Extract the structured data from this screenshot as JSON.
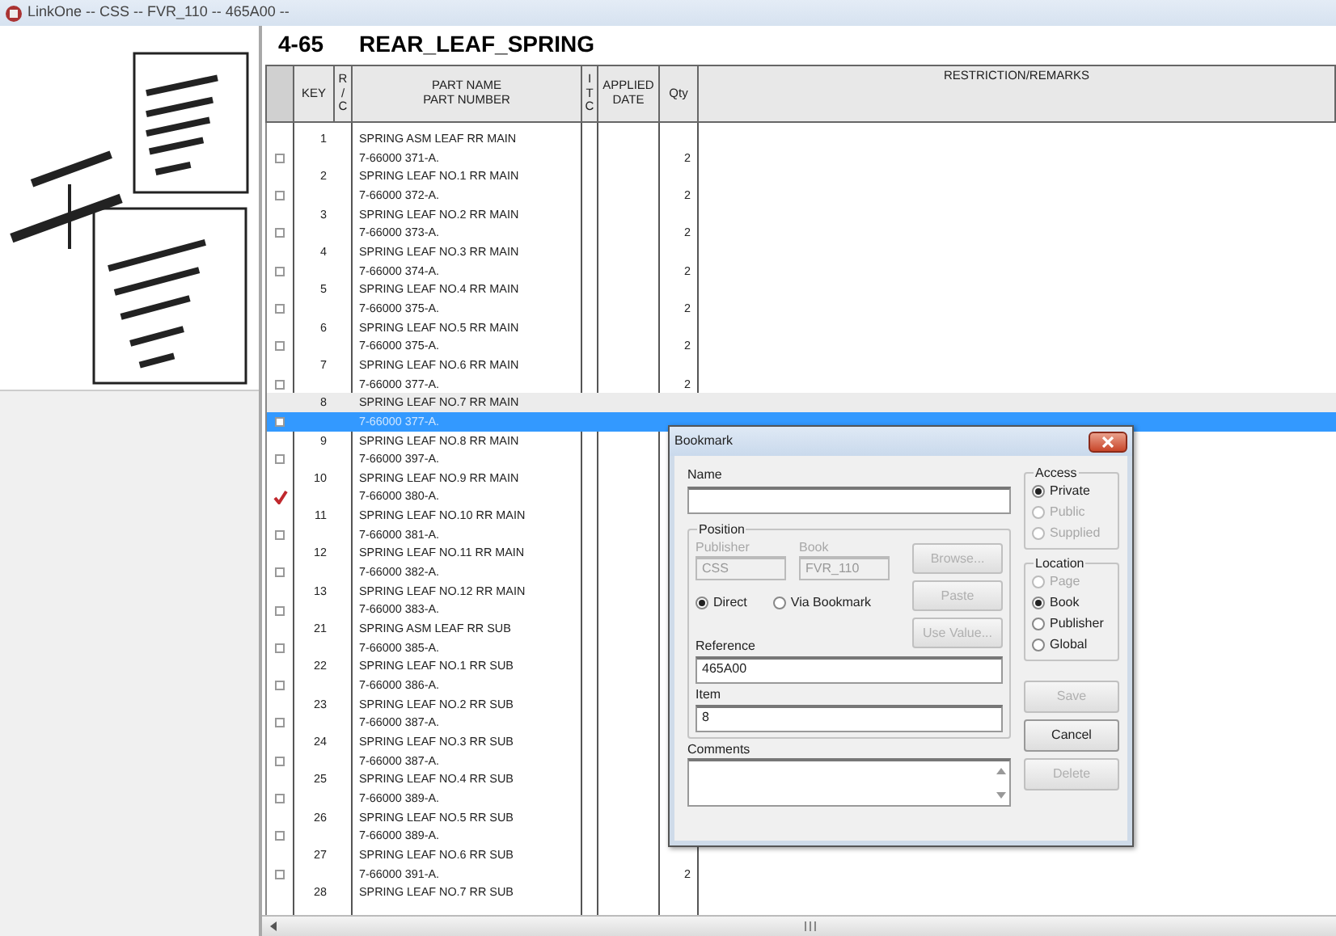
{
  "window": {
    "title": "LinkOne -- CSS -- FVR_110 -- 465A00 --"
  },
  "page": {
    "number": "4-65",
    "title": "REAR_LEAF_SPRING"
  },
  "table": {
    "columns": [
      {
        "kind": "key",
        "lines": [
          "KEY"
        ]
      },
      {
        "kind": "rc",
        "lines": [
          "R",
          "/",
          "C"
        ]
      },
      {
        "kind": "part",
        "lines": [
          "PART NAME",
          "PART NUMBER"
        ]
      },
      {
        "kind": "itc",
        "lines": [
          "I",
          "T",
          "C"
        ]
      },
      {
        "kind": "date",
        "lines": [
          "APPLIED",
          "DATE"
        ]
      },
      {
        "kind": "qty",
        "lines": [
          "Qty"
        ]
      },
      {
        "kind": "remarks",
        "lines": [
          "RESTRICTION/REMARKS"
        ]
      }
    ],
    "rows": [
      {
        "key": "1",
        "part_name": "SPRING ASM LEAF RR MAIN",
        "part_number": "7-66000 371-A.",
        "qty": "2",
        "checked": false,
        "selected": false
      },
      {
        "key": "2",
        "part_name": "SPRING LEAF NO.1 RR MAIN",
        "part_number": "7-66000 372-A.",
        "qty": "2",
        "checked": false,
        "selected": false
      },
      {
        "key": "3",
        "part_name": "SPRING LEAF NO.2 RR MAIN",
        "part_number": "7-66000 373-A.",
        "qty": "2",
        "checked": false,
        "selected": false
      },
      {
        "key": "4",
        "part_name": "SPRING LEAF NO.3 RR MAIN",
        "part_number": "7-66000 374-A.",
        "qty": "2",
        "checked": false,
        "selected": false
      },
      {
        "key": "5",
        "part_name": "SPRING LEAF NO.4 RR MAIN",
        "part_number": "7-66000 375-A.",
        "qty": "2",
        "checked": false,
        "selected": false
      },
      {
        "key": "6",
        "part_name": "SPRING LEAF NO.5 RR MAIN",
        "part_number": "7-66000 375-A.",
        "qty": "2",
        "checked": false,
        "selected": false
      },
      {
        "key": "7",
        "part_name": "SPRING LEAF NO.6 RR MAIN",
        "part_number": "7-66000 377-A.",
        "qty": "2",
        "checked": false,
        "selected": false
      },
      {
        "key": "8",
        "part_name": "SPRING LEAF NO.7 RR MAIN",
        "part_number": "7-66000 377-A.",
        "checked": false,
        "selected": true
      },
      {
        "key": "9",
        "part_name": "SPRING LEAF NO.8 RR MAIN",
        "part_number": "7-66000 397-A.",
        "checked": false,
        "selected": false
      },
      {
        "key": "10",
        "part_name": "SPRING LEAF NO.9 RR MAIN",
        "part_number": "7-66000 380-A.",
        "checked": true,
        "selected": false
      },
      {
        "key": "11",
        "part_name": "SPRING LEAF NO.10 RR MAIN",
        "part_number": "7-66000 381-A.",
        "checked": false,
        "selected": false
      },
      {
        "key": "12",
        "part_name": "SPRING LEAF NO.11 RR MAIN",
        "part_number": "7-66000 382-A.",
        "checked": false,
        "selected": false
      },
      {
        "key": "13",
        "part_name": "SPRING LEAF NO.12 RR MAIN",
        "part_number": "7-66000 383-A.",
        "checked": false,
        "selected": false
      },
      {
        "key": "21",
        "part_name": "SPRING ASM LEAF RR SUB",
        "part_number": "7-66000 385-A.",
        "checked": false,
        "selected": false
      },
      {
        "key": "22",
        "part_name": "SPRING LEAF NO.1 RR SUB",
        "part_number": "7-66000 386-A.",
        "checked": false,
        "selected": false
      },
      {
        "key": "23",
        "part_name": "SPRING LEAF NO.2 RR SUB",
        "part_number": "7-66000 387-A.",
        "checked": false,
        "selected": false
      },
      {
        "key": "24",
        "part_name": "SPRING LEAF NO.3 RR SUB",
        "part_number": "7-66000 387-A.",
        "checked": false,
        "selected": false
      },
      {
        "key": "25",
        "part_name": "SPRING LEAF NO.4 RR SUB",
        "part_number": "7-66000 389-A.",
        "checked": false,
        "selected": false
      },
      {
        "key": "26",
        "part_name": "SPRING LEAF NO.5 RR SUB",
        "part_number": "7-66000 389-A.",
        "checked": false,
        "selected": false
      },
      {
        "key": "27",
        "part_name": "SPRING LEAF NO.6 RR SUB",
        "part_number": "7-66000 391-A.",
        "qty": "2",
        "checked": false,
        "selected": false
      },
      {
        "key": "28",
        "part_name": "SPRING LEAF NO.7 RR SUB"
      }
    ]
  },
  "bookmark_dialog": {
    "title": "Bookmark",
    "name": {
      "label": "Name"
    },
    "position": {
      "label": "Position",
      "publisher": {
        "label": "Publisher",
        "value": "CSS"
      },
      "book": {
        "label": "Book",
        "value": "FVR_110"
      },
      "buttons": [
        {
          "label": "Browse...",
          "disabled": true
        },
        {
          "label": "Paste",
          "disabled": true
        },
        {
          "label": "Use Value...",
          "disabled": true
        }
      ],
      "link_type": [
        {
          "label": "Direct",
          "selected": true
        },
        {
          "label": "Via Bookmark",
          "selected": false
        }
      ],
      "reference": {
        "label": "Reference",
        "value": "465A00"
      },
      "item": {
        "label": "Item",
        "value": "8"
      }
    },
    "comments": {
      "label": "Comments"
    },
    "access": {
      "label": "Access",
      "options": [
        {
          "label": "Private",
          "selected": true,
          "disabled": false
        },
        {
          "label": "Public",
          "selected": false,
          "disabled": true
        },
        {
          "label": "Supplied",
          "selected": false,
          "disabled": true
        }
      ]
    },
    "location": {
      "label": "Location",
      "options": [
        {
          "label": "Page",
          "selected": false,
          "disabled": true
        },
        {
          "label": "Book",
          "selected": true,
          "disabled": false
        },
        {
          "label": "Publisher",
          "selected": false,
          "disabled": false
        },
        {
          "label": "Global",
          "selected": false,
          "disabled": false
        }
      ]
    },
    "buttons": [
      {
        "label": "Save",
        "disabled": true
      },
      {
        "label": "Cancel",
        "disabled": false
      },
      {
        "label": "Delete",
        "disabled": true
      }
    ]
  }
}
